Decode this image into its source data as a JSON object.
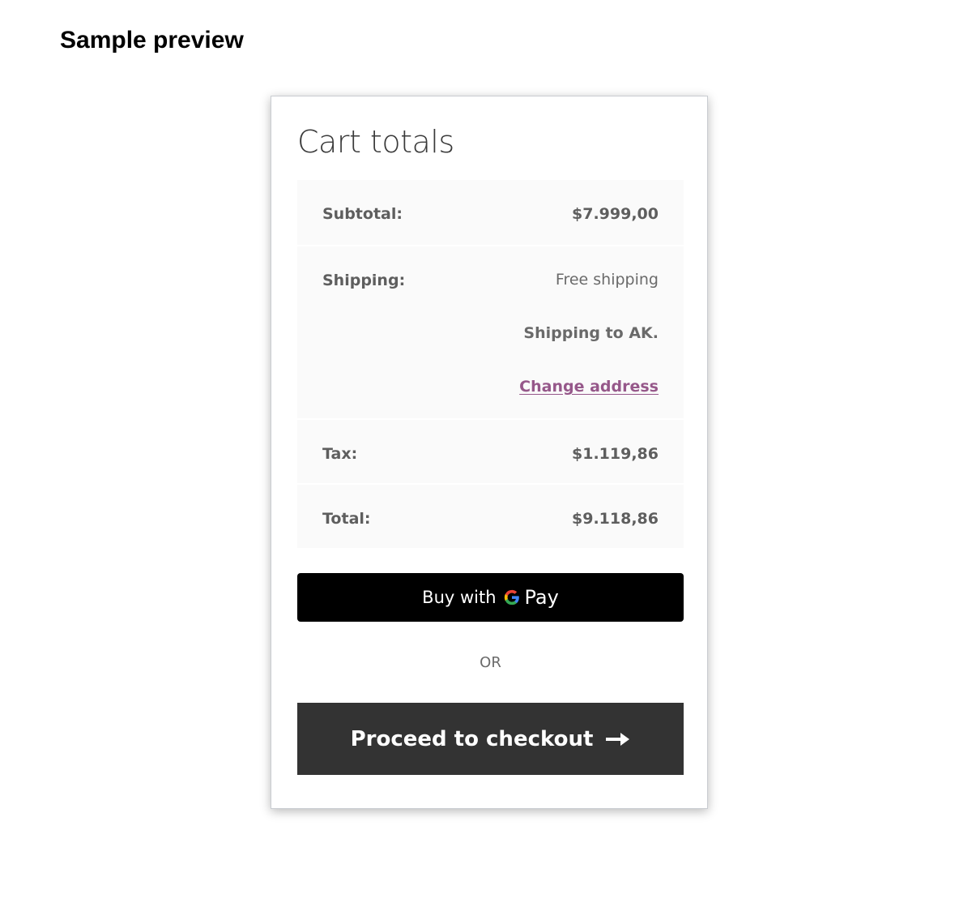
{
  "page": {
    "heading": "Sample preview"
  },
  "cart": {
    "title": "Cart totals",
    "subtotal": {
      "label": "Subtotal:",
      "value": "$7.999,00"
    },
    "shipping": {
      "label": "Shipping:",
      "method": "Free shipping",
      "destination": "Shipping to AK.",
      "change_link": "Change address"
    },
    "tax": {
      "label": "Tax:",
      "value": "$1.119,86"
    },
    "total": {
      "label": "Total:",
      "value": "$9.118,86"
    }
  },
  "payment": {
    "gpay_label": "Buy with",
    "gpay_brand_letter_icon": "google-g-icon",
    "gpay_word": "Pay",
    "separator": "OR",
    "checkout_label": "Proceed to checkout",
    "checkout_icon": "arrow-right-icon"
  },
  "colors": {
    "link": "#96588a",
    "checkout_button": "#333333",
    "gpay_button": "#000000",
    "row_background": "#fafafa"
  }
}
